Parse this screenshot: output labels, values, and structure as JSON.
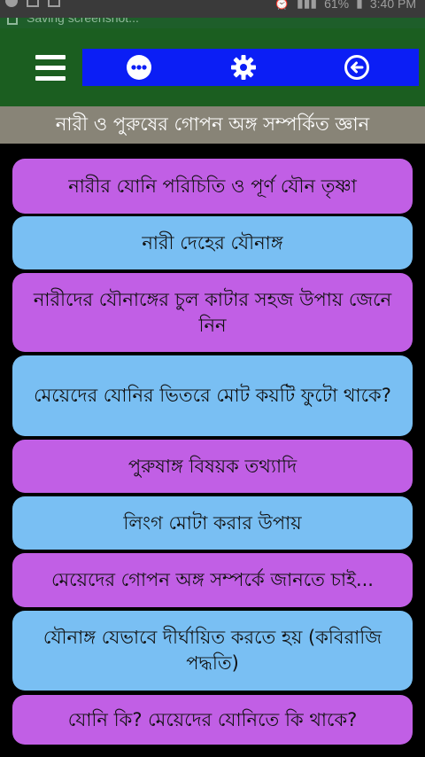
{
  "status_bar": {
    "battery": "61%",
    "time": "3:40 PM"
  },
  "notification": {
    "text": "Saving screenshot..."
  },
  "toolbar": {
    "icons": [
      "menu-icon",
      "more-icon",
      "gear-icon",
      "back-icon"
    ]
  },
  "subtitle": "নারী ও পুরুষের গোপন অঙ্গ সম্পর্কিত জ্ঞান",
  "items": [
    {
      "label": "নারীর যোনি পরিচিতি ও পূর্ণ যৌন তৃষ্ণা"
    },
    {
      "label": "নারী দেহের যৌনাঙ্গ"
    },
    {
      "label": "নারীদের যৌনাঙ্গের চুল কাটার সহজ উপায় জেনে নিন"
    },
    {
      "label": "মেয়েদের যোনির ভিতরে মোট কয়টি ফুটো থাকে?"
    },
    {
      "label": "পুরুষাঙ্গ বিষয়ক তথ্যাদি"
    },
    {
      "label": "লিংগ মোটা করার উপায়"
    },
    {
      "label": "মেয়েদের গোপন অঙ্গ সম্পর্কে জানতে চাই..."
    },
    {
      "label": "যৌনাঙ্গ যেভাবে দীর্ঘায়িত করতে হয় (কবিরাজি পদ্ধতি)"
    },
    {
      "label": "যোনি কি? মেয়েদের যোনিতে কি থাকে?"
    }
  ],
  "colors": {
    "toolbar": "#1b5e20",
    "action_bar": "#0b1ef5",
    "subtitle_bar": "#888477",
    "item_purple": "#c15fe5",
    "item_blue": "#79bff3"
  }
}
